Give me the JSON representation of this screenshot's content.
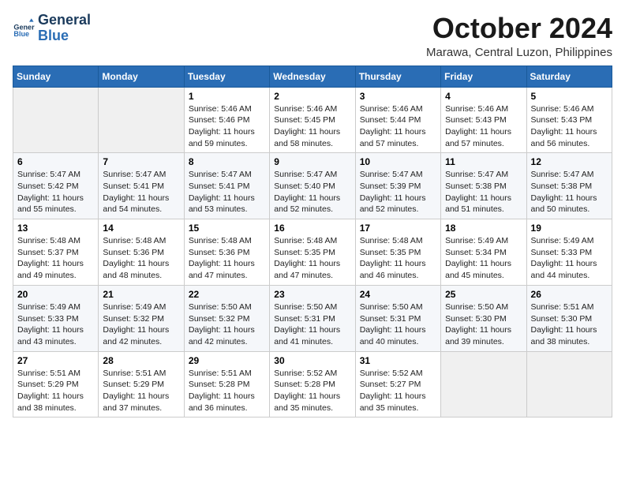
{
  "header": {
    "logo_line1": "General",
    "logo_line2": "Blue",
    "month": "October 2024",
    "location": "Marawa, Central Luzon, Philippines"
  },
  "days_of_week": [
    "Sunday",
    "Monday",
    "Tuesday",
    "Wednesday",
    "Thursday",
    "Friday",
    "Saturday"
  ],
  "weeks": [
    [
      {
        "day": "",
        "info": ""
      },
      {
        "day": "",
        "info": ""
      },
      {
        "day": "1",
        "info": "Sunrise: 5:46 AM\nSunset: 5:46 PM\nDaylight: 11 hours and 59 minutes."
      },
      {
        "day": "2",
        "info": "Sunrise: 5:46 AM\nSunset: 5:45 PM\nDaylight: 11 hours and 58 minutes."
      },
      {
        "day": "3",
        "info": "Sunrise: 5:46 AM\nSunset: 5:44 PM\nDaylight: 11 hours and 57 minutes."
      },
      {
        "day": "4",
        "info": "Sunrise: 5:46 AM\nSunset: 5:43 PM\nDaylight: 11 hours and 57 minutes."
      },
      {
        "day": "5",
        "info": "Sunrise: 5:46 AM\nSunset: 5:43 PM\nDaylight: 11 hours and 56 minutes."
      }
    ],
    [
      {
        "day": "6",
        "info": "Sunrise: 5:47 AM\nSunset: 5:42 PM\nDaylight: 11 hours and 55 minutes."
      },
      {
        "day": "7",
        "info": "Sunrise: 5:47 AM\nSunset: 5:41 PM\nDaylight: 11 hours and 54 minutes."
      },
      {
        "day": "8",
        "info": "Sunrise: 5:47 AM\nSunset: 5:41 PM\nDaylight: 11 hours and 53 minutes."
      },
      {
        "day": "9",
        "info": "Sunrise: 5:47 AM\nSunset: 5:40 PM\nDaylight: 11 hours and 52 minutes."
      },
      {
        "day": "10",
        "info": "Sunrise: 5:47 AM\nSunset: 5:39 PM\nDaylight: 11 hours and 52 minutes."
      },
      {
        "day": "11",
        "info": "Sunrise: 5:47 AM\nSunset: 5:38 PM\nDaylight: 11 hours and 51 minutes."
      },
      {
        "day": "12",
        "info": "Sunrise: 5:47 AM\nSunset: 5:38 PM\nDaylight: 11 hours and 50 minutes."
      }
    ],
    [
      {
        "day": "13",
        "info": "Sunrise: 5:48 AM\nSunset: 5:37 PM\nDaylight: 11 hours and 49 minutes."
      },
      {
        "day": "14",
        "info": "Sunrise: 5:48 AM\nSunset: 5:36 PM\nDaylight: 11 hours and 48 minutes."
      },
      {
        "day": "15",
        "info": "Sunrise: 5:48 AM\nSunset: 5:36 PM\nDaylight: 11 hours and 47 minutes."
      },
      {
        "day": "16",
        "info": "Sunrise: 5:48 AM\nSunset: 5:35 PM\nDaylight: 11 hours and 47 minutes."
      },
      {
        "day": "17",
        "info": "Sunrise: 5:48 AM\nSunset: 5:35 PM\nDaylight: 11 hours and 46 minutes."
      },
      {
        "day": "18",
        "info": "Sunrise: 5:49 AM\nSunset: 5:34 PM\nDaylight: 11 hours and 45 minutes."
      },
      {
        "day": "19",
        "info": "Sunrise: 5:49 AM\nSunset: 5:33 PM\nDaylight: 11 hours and 44 minutes."
      }
    ],
    [
      {
        "day": "20",
        "info": "Sunrise: 5:49 AM\nSunset: 5:33 PM\nDaylight: 11 hours and 43 minutes."
      },
      {
        "day": "21",
        "info": "Sunrise: 5:49 AM\nSunset: 5:32 PM\nDaylight: 11 hours and 42 minutes."
      },
      {
        "day": "22",
        "info": "Sunrise: 5:50 AM\nSunset: 5:32 PM\nDaylight: 11 hours and 42 minutes."
      },
      {
        "day": "23",
        "info": "Sunrise: 5:50 AM\nSunset: 5:31 PM\nDaylight: 11 hours and 41 minutes."
      },
      {
        "day": "24",
        "info": "Sunrise: 5:50 AM\nSunset: 5:31 PM\nDaylight: 11 hours and 40 minutes."
      },
      {
        "day": "25",
        "info": "Sunrise: 5:50 AM\nSunset: 5:30 PM\nDaylight: 11 hours and 39 minutes."
      },
      {
        "day": "26",
        "info": "Sunrise: 5:51 AM\nSunset: 5:30 PM\nDaylight: 11 hours and 38 minutes."
      }
    ],
    [
      {
        "day": "27",
        "info": "Sunrise: 5:51 AM\nSunset: 5:29 PM\nDaylight: 11 hours and 38 minutes."
      },
      {
        "day": "28",
        "info": "Sunrise: 5:51 AM\nSunset: 5:29 PM\nDaylight: 11 hours and 37 minutes."
      },
      {
        "day": "29",
        "info": "Sunrise: 5:51 AM\nSunset: 5:28 PM\nDaylight: 11 hours and 36 minutes."
      },
      {
        "day": "30",
        "info": "Sunrise: 5:52 AM\nSunset: 5:28 PM\nDaylight: 11 hours and 35 minutes."
      },
      {
        "day": "31",
        "info": "Sunrise: 5:52 AM\nSunset: 5:27 PM\nDaylight: 11 hours and 35 minutes."
      },
      {
        "day": "",
        "info": ""
      },
      {
        "day": "",
        "info": ""
      }
    ]
  ]
}
